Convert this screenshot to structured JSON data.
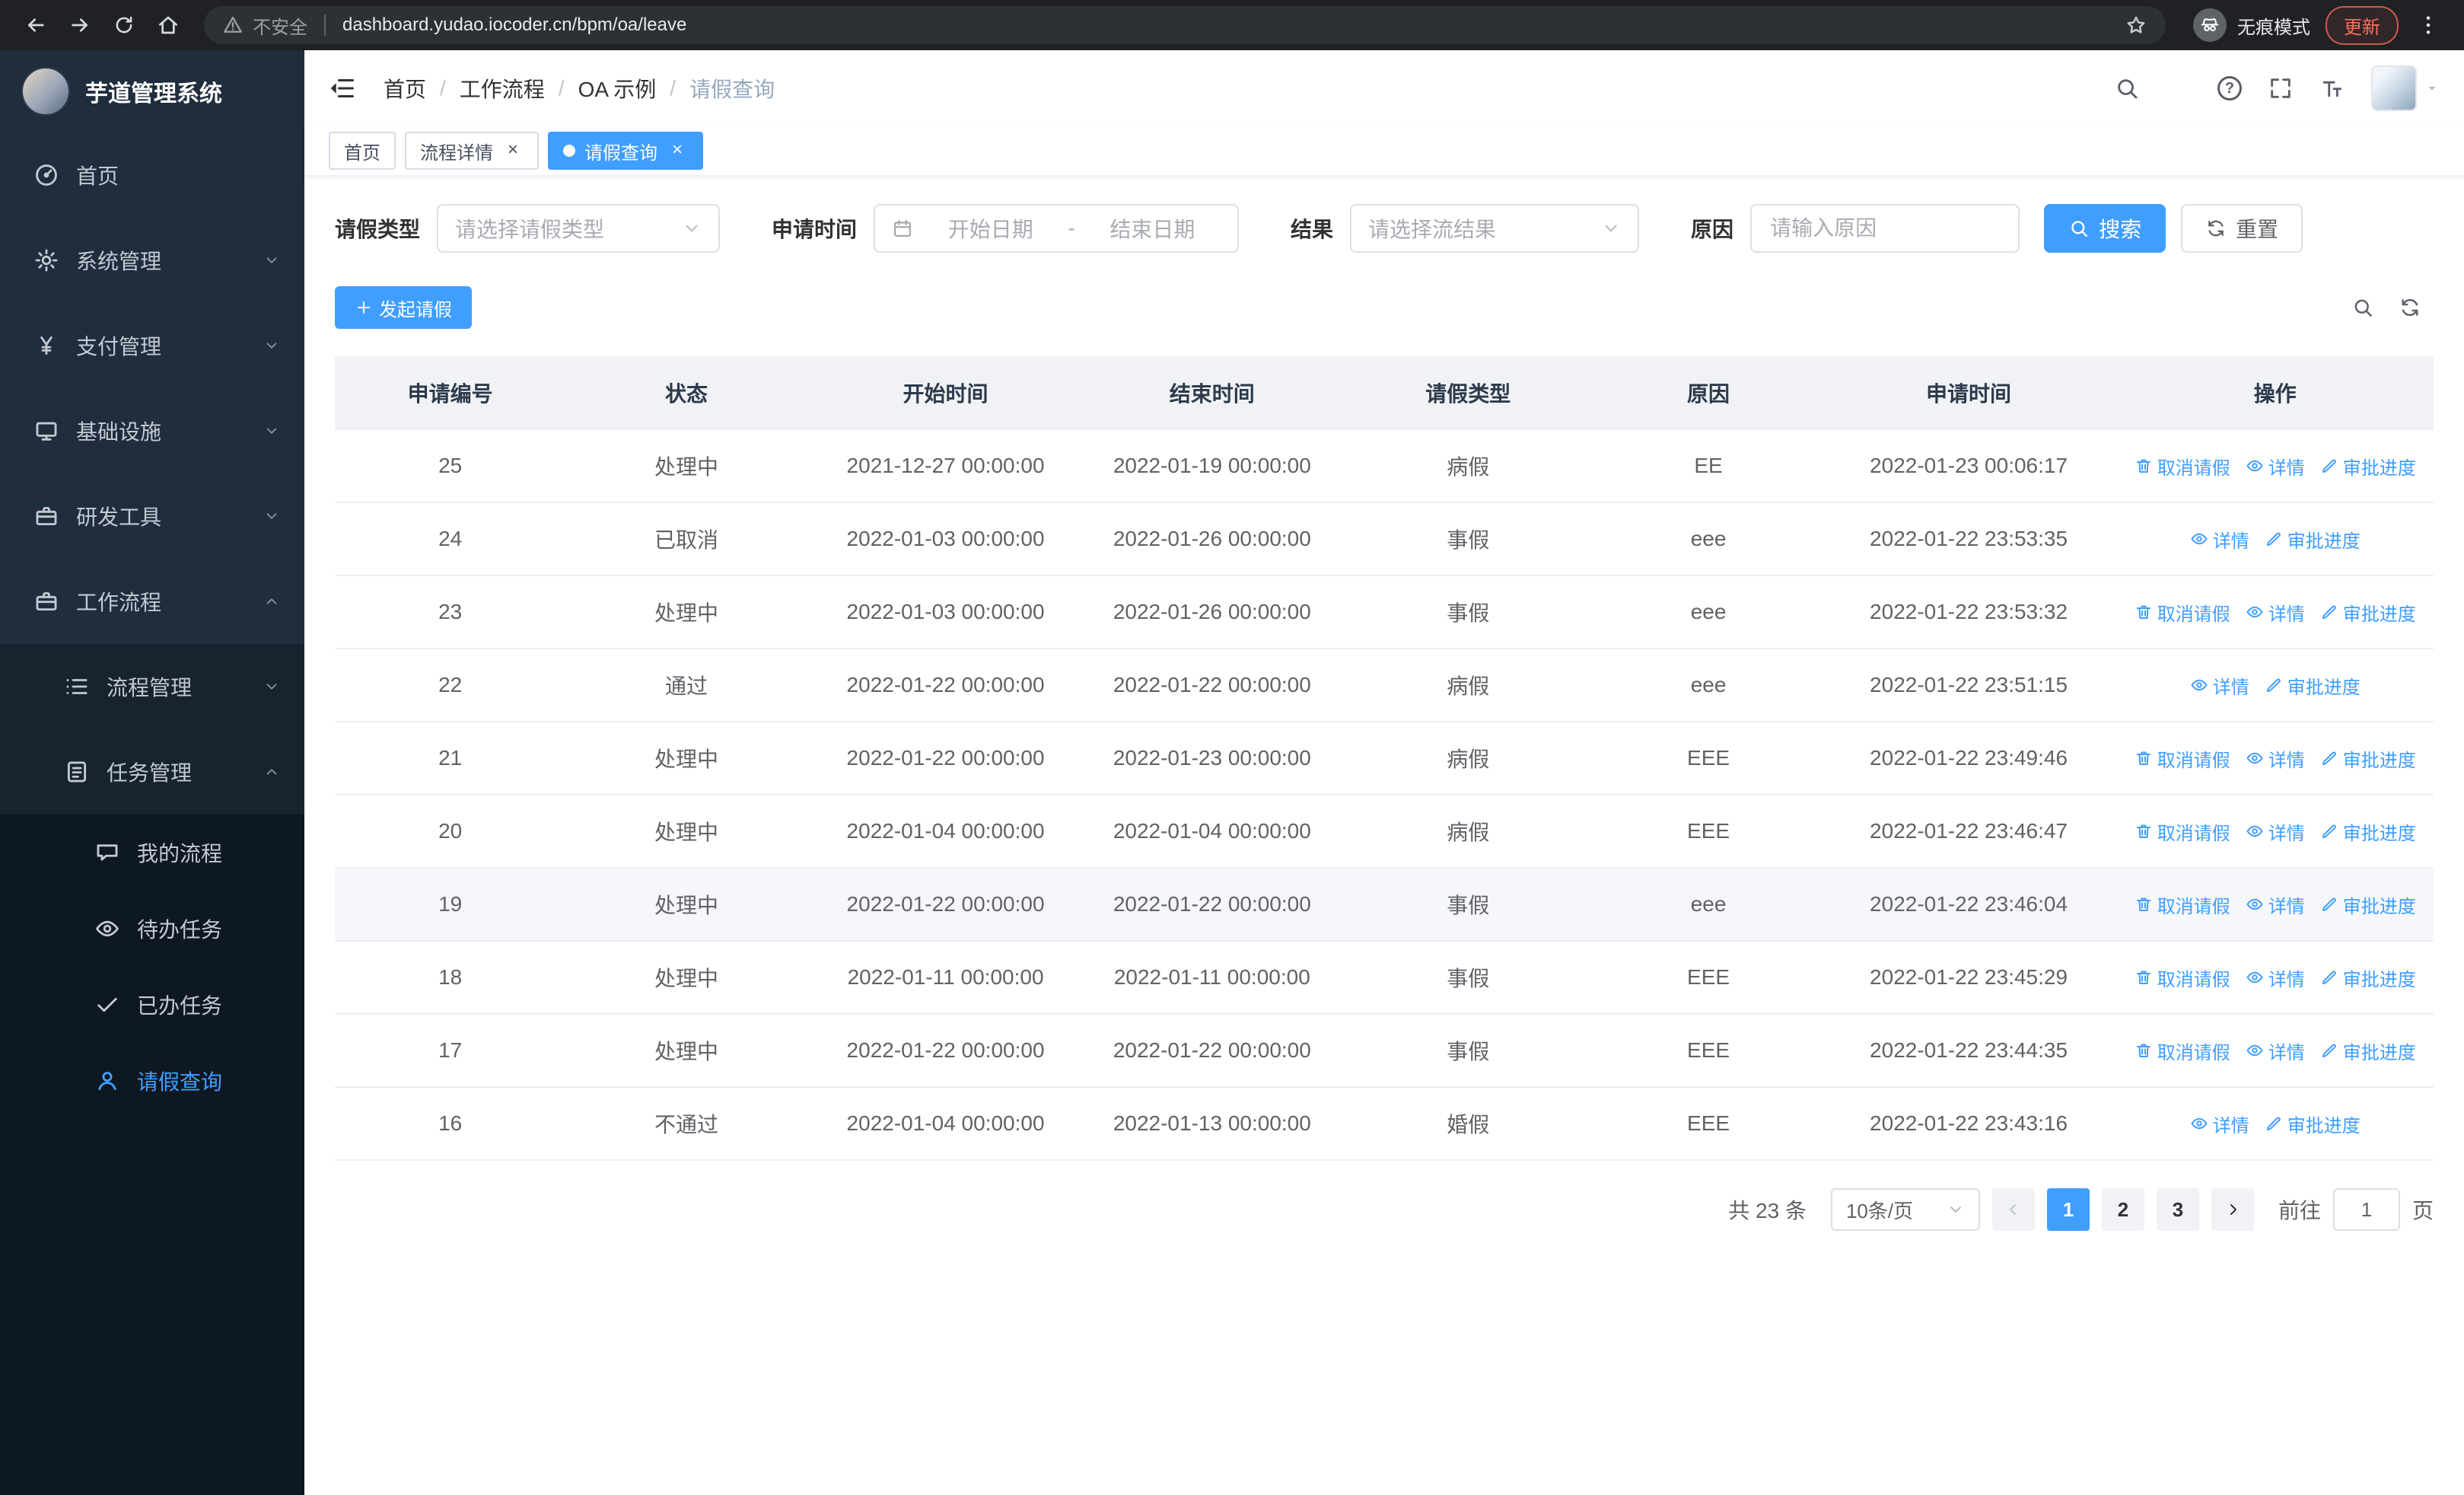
{
  "browser": {
    "security_label": "不安全",
    "url": "dashboard.yudao.iocoder.cn/bpm/oa/leave",
    "incognito_label": "无痕模式",
    "update_label": "更新"
  },
  "sidebar": {
    "logo_title": "芋道管理系统",
    "items": [
      {
        "key": "home",
        "label": "首页",
        "icon": "dashboard-icon",
        "glyph": "dashboard",
        "level": 1
      },
      {
        "key": "system-mgmt",
        "label": "系统管理",
        "icon": "gear-icon",
        "glyph": "gear",
        "level": 1,
        "arrow": "down"
      },
      {
        "key": "payment-mgmt",
        "label": "支付管理",
        "icon": "yen-icon",
        "glyph": "yen",
        "level": 1,
        "arrow": "down"
      },
      {
        "key": "infrastructure",
        "label": "基础设施",
        "icon": "infrastructure-icon",
        "glyph": "monitor",
        "level": 1,
        "arrow": "down"
      },
      {
        "key": "dev-tools",
        "label": "研发工具",
        "icon": "toolbox-icon",
        "glyph": "briefcase",
        "level": 1,
        "arrow": "down"
      },
      {
        "key": "workflow",
        "label": "工作流程",
        "icon": "workflow-icon",
        "glyph": "briefcase",
        "level": 1,
        "arrow": "up"
      },
      {
        "key": "process-mgmt",
        "label": "流程管理",
        "icon": "process-list-icon",
        "glyph": "list",
        "level": 2,
        "arrow": "down"
      },
      {
        "key": "task-mgmt",
        "label": "任务管理",
        "icon": "task-icon",
        "glyph": "document",
        "level": 2,
        "arrow": "up"
      },
      {
        "key": "my-process",
        "label": "我的流程",
        "icon": "chat-icon",
        "glyph": "chat",
        "level": 3
      },
      {
        "key": "todo-tasks",
        "label": "待办任务",
        "icon": "eye-icon",
        "glyph": "eye",
        "level": 3
      },
      {
        "key": "done-tasks",
        "label": "已办任务",
        "icon": "check-icon",
        "glyph": "check",
        "level": 3
      },
      {
        "key": "leave-query",
        "label": "请假查询",
        "icon": "user-icon",
        "glyph": "user",
        "level": 3,
        "active": true
      }
    ]
  },
  "header": {
    "separator": "/",
    "breadcrumb": [
      "首页",
      "工作流程",
      "OA 示例",
      "请假查询"
    ]
  },
  "tabs": [
    {
      "label": "首页",
      "active": false,
      "closable": false
    },
    {
      "label": "流程详情",
      "active": false,
      "closable": true
    },
    {
      "label": "请假查询",
      "active": true,
      "closable": true
    }
  ],
  "filters": {
    "leave_type_label": "请假类型",
    "leave_type_placeholder": "请选择请假类型",
    "apply_time_label": "申请时间",
    "date_start_placeholder": "开始日期",
    "date_separator": "-",
    "date_end_placeholder": "结束日期",
    "result_label": "结果",
    "result_placeholder": "请选择流结果",
    "reason_label": "原因",
    "reason_placeholder": "请输入原因",
    "search_label": "搜索",
    "reset_label": "重置"
  },
  "toolbar": {
    "create_label": "发起请假"
  },
  "table": {
    "columns": [
      "申请编号",
      "状态",
      "开始时间",
      "结束时间",
      "请假类型",
      "原因",
      "申请时间",
      "操作"
    ],
    "ops": {
      "cancel": "取消请假",
      "detail": "详情",
      "progress": "审批进度"
    },
    "rows": [
      {
        "id": "25",
        "status": "处理中",
        "start": "2021-12-27 00:00:00",
        "end": "2022-01-19 00:00:00",
        "type": "病假",
        "reason": "EE",
        "applied": "2022-01-23 00:06:17",
        "can_cancel": true
      },
      {
        "id": "24",
        "status": "已取消",
        "start": "2022-01-03 00:00:00",
        "end": "2022-01-26 00:00:00",
        "type": "事假",
        "reason": "eee",
        "applied": "2022-01-22 23:53:35",
        "can_cancel": false
      },
      {
        "id": "23",
        "status": "处理中",
        "start": "2022-01-03 00:00:00",
        "end": "2022-01-26 00:00:00",
        "type": "事假",
        "reason": "eee",
        "applied": "2022-01-22 23:53:32",
        "can_cancel": true
      },
      {
        "id": "22",
        "status": "通过",
        "start": "2022-01-22 00:00:00",
        "end": "2022-01-22 00:00:00",
        "type": "病假",
        "reason": "eee",
        "applied": "2022-01-22 23:51:15",
        "can_cancel": false
      },
      {
        "id": "21",
        "status": "处理中",
        "start": "2022-01-22 00:00:00",
        "end": "2022-01-23 00:00:00",
        "type": "病假",
        "reason": "EEE",
        "applied": "2022-01-22 23:49:46",
        "can_cancel": true
      },
      {
        "id": "20",
        "status": "处理中",
        "start": "2022-01-04 00:00:00",
        "end": "2022-01-04 00:00:00",
        "type": "病假",
        "reason": "EEE",
        "applied": "2022-01-22 23:46:47",
        "can_cancel": true
      },
      {
        "id": "19",
        "status": "处理中",
        "start": "2022-01-22 00:00:00",
        "end": "2022-01-22 00:00:00",
        "type": "事假",
        "reason": "eee",
        "applied": "2022-01-22 23:46:04",
        "can_cancel": true,
        "highlighted": true
      },
      {
        "id": "18",
        "status": "处理中",
        "start": "2022-01-11 00:00:00",
        "end": "2022-01-11 00:00:00",
        "type": "事假",
        "reason": "EEE",
        "applied": "2022-01-22 23:45:29",
        "can_cancel": true
      },
      {
        "id": "17",
        "status": "处理中",
        "start": "2022-01-22 00:00:00",
        "end": "2022-01-22 00:00:00",
        "type": "事假",
        "reason": "EEE",
        "applied": "2022-01-22 23:44:35",
        "can_cancel": true
      },
      {
        "id": "16",
        "status": "不通过",
        "start": "2022-01-04 00:00:00",
        "end": "2022-01-13 00:00:00",
        "type": "婚假",
        "reason": "EEE",
        "applied": "2022-01-22 23:43:16",
        "can_cancel": false
      }
    ]
  },
  "pagination": {
    "total_label": "共 23 条",
    "page_size_label": "10条/页",
    "pages": [
      "1",
      "2",
      "3"
    ],
    "active_page": "1",
    "jump_prefix": "前往",
    "jump_value": "1",
    "jump_suffix": "页"
  }
}
